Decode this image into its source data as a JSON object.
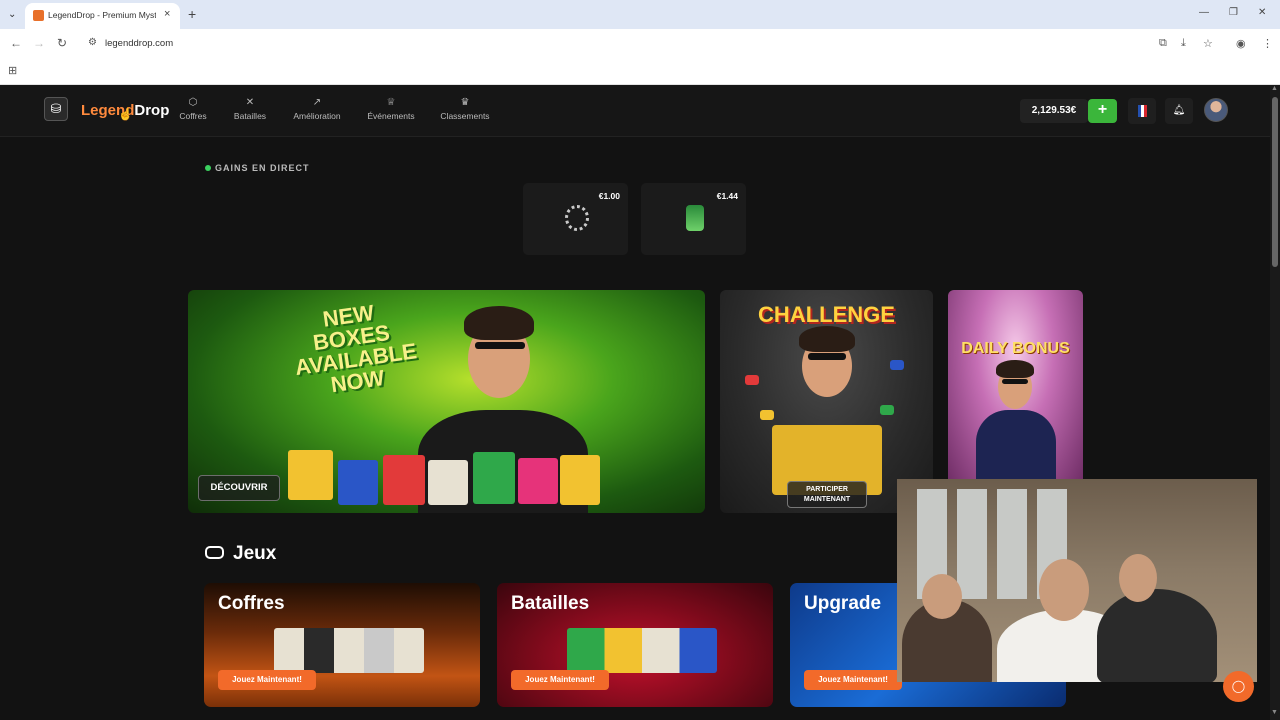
{
  "browser": {
    "tab_title": "LegendDrop - Premium Myster",
    "url": "legenddrop.com",
    "tab_close_icon": "×",
    "new_tab_icon": "+"
  },
  "site": {
    "logo": {
      "part1": "Legen",
      "part2": "Drop",
      "accent_letter": "d"
    },
    "nav": [
      {
        "label": "Coffres",
        "icon": "box-icon"
      },
      {
        "label": "Batailles",
        "icon": "swords-icon"
      },
      {
        "label": "Amélioration",
        "icon": "trend-up-icon"
      },
      {
        "label": "Événements",
        "icon": "trophy-icon"
      },
      {
        "label": "Classements",
        "icon": "crown-icon"
      }
    ],
    "balance": "2,129.53€",
    "plus_label": "+",
    "accent_color": "#f26a2a",
    "green_color": "#3bb63b"
  },
  "live_wins": {
    "label": "GAINS EN DIRECT",
    "items": [
      {
        "price": "€1.00",
        "icon": "bracelet-icon"
      },
      {
        "price": "€1.44",
        "icon": "green-bottle-icon"
      }
    ]
  },
  "banners": {
    "main": {
      "headline": "NEW BOXES AVAILABLE NOW",
      "button": "DÉCOUVRIR"
    },
    "challenge": {
      "headline": "CHALLENGE",
      "button_line1": "PARTICIPER",
      "button_line2": "MAINTENANT"
    },
    "daily": {
      "headline": "DAILY BONUS"
    }
  },
  "games": {
    "title": "Jeux",
    "cards": [
      {
        "title": "Coffres",
        "button": "Jouez Maintenant!"
      },
      {
        "title": "Batailles",
        "button": "Jouez Maintenant!"
      },
      {
        "title": "Upgrade",
        "button": "Jouez Maintenant!"
      }
    ]
  }
}
